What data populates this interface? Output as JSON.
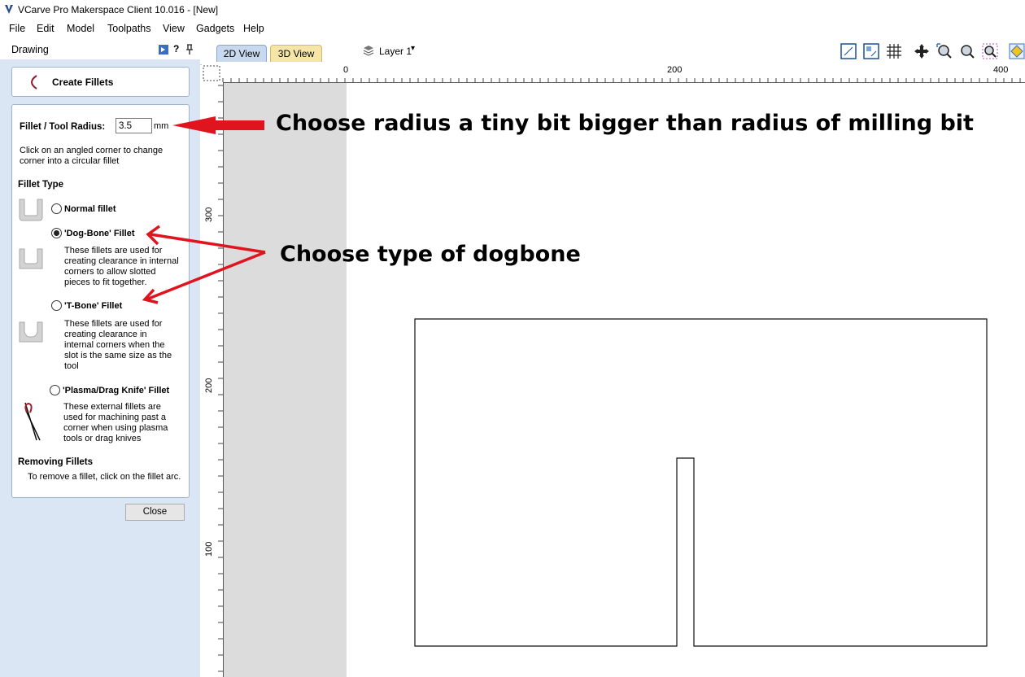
{
  "window": {
    "title": "VCarve Pro Makerspace Client 10.016 - [New]"
  },
  "menu": [
    "File",
    "Edit",
    "Model",
    "Toolpaths",
    "View",
    "Gadgets",
    "Help"
  ],
  "panel": {
    "header": "Drawing",
    "help_glyph": "?",
    "form_title": "Create Fillets",
    "radius_label": "Fillet / Tool Radius:",
    "radius_value": "3.5",
    "radius_unit": "mm",
    "instruction": "Click on an angled corner to change corner into a circular fillet",
    "fillet_type_heading": "Fillet Type",
    "options": [
      {
        "label": "Normal fillet",
        "selected": false,
        "desc": ""
      },
      {
        "label": "'Dog-Bone' Fillet",
        "selected": true,
        "desc": "These fillets are used for creating clearance in internal corners to allow slotted pieces to fit together."
      },
      {
        "label": "'T-Bone' Fillet",
        "selected": false,
        "desc": "These fillets are used for creating clearance in internal corners when the slot is the same size as the tool"
      },
      {
        "label": "'Plasma/Drag Knife' Fillet",
        "selected": false,
        "desc": "These external fillets are used for machining past a corner when using plasma tools or drag knives"
      }
    ],
    "removing_heading": "Removing Fillets",
    "removing_text": "To remove a fillet, click on the fillet arc.",
    "close_label": "Close"
  },
  "view": {
    "tab_2d": "2D View",
    "tab_3d": "3D View",
    "layer": "Layer 1",
    "ruler_h": [
      "0",
      "200",
      "400"
    ],
    "ruler_v": [
      "300",
      "200",
      "100"
    ]
  },
  "annotations": {
    "radius_note": "Choose radius a tiny bit bigger than radius of milling bit",
    "type_note": "Choose type of dogbone"
  },
  "colors": {
    "arrow": "#e0141e",
    "panel_bg": "#dbe6f4",
    "tab_2d": "#c8d8ee",
    "tab_3d": "#f5e6a8"
  }
}
